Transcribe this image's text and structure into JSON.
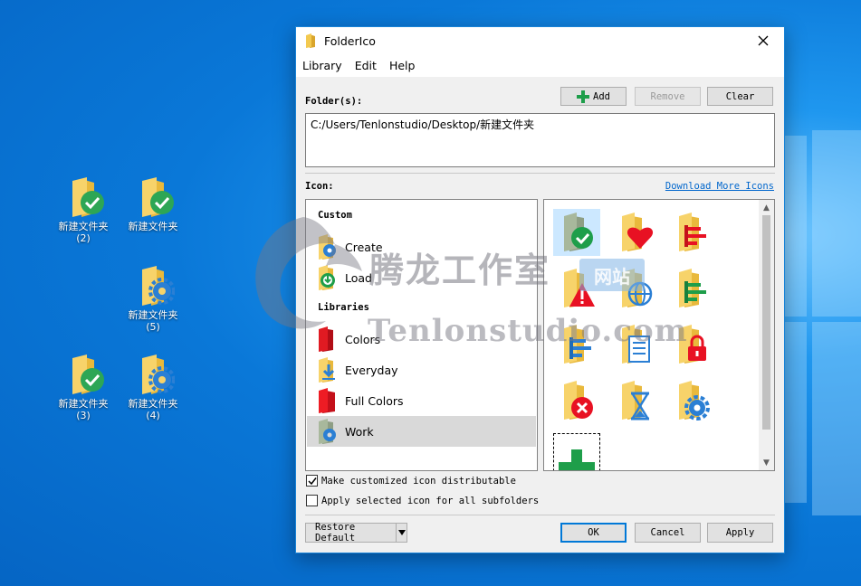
{
  "desktop": {
    "icons": [
      {
        "label": "新建文件夹\n(2)",
        "badge": "check-icon"
      },
      {
        "label": "新建文件夹",
        "badge": "check-icon"
      },
      {
        "label": "新建文件夹\n(5)",
        "badge": "gear-icon"
      },
      {
        "label": "新建文件夹\n(3)",
        "badge": "check-icon"
      },
      {
        "label": "新建文件夹\n(4)",
        "badge": "gear-icon"
      }
    ]
  },
  "dialog": {
    "title": "FolderIco",
    "menu": [
      "Library",
      "Edit",
      "Help"
    ],
    "folders_label": "Folder(s):",
    "buttons": {
      "add": "Add",
      "remove": "Remove",
      "clear": "Clear"
    },
    "folder_path": "C:/Users/Tenlonstudio/Desktop/新建文件夹",
    "icon_label": "Icon:",
    "download_link": "Download More Icons",
    "library": {
      "custom_header": "Custom",
      "custom_items": [
        "Create",
        "Load"
      ],
      "libraries_header": "Libraries",
      "library_items": [
        "Colors",
        "Everyday",
        "Full Colors",
        "Work"
      ],
      "selected": "Work"
    },
    "icon_grid": [
      "check",
      "heart",
      "chart-bars",
      "warning",
      "www-globe",
      "chart-bars-green",
      "list-bars",
      "document-list",
      "lock",
      "error-x",
      "hourglass",
      "gear",
      "plus-add"
    ],
    "checkbox_distributable": {
      "label": "Make customized icon distributable",
      "checked": true
    },
    "checkbox_subfolders": {
      "label": "Apply selected icon for all subfolders",
      "checked": false
    },
    "restore_default": "Restore Default",
    "ok": "OK",
    "cancel": "Cancel",
    "apply": "Apply"
  },
  "watermark": {
    "cn": "腾龙工作室",
    "badge": "网站",
    "en": "Tenlonstudio.com"
  },
  "colors": {
    "accent": "#0078d7",
    "folder": "#f5cf5b",
    "green": "#1e9e4a",
    "red": "#e81123",
    "blue": "#2b7fd4"
  }
}
